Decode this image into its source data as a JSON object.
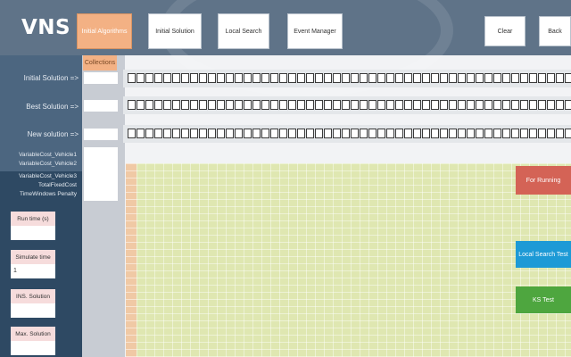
{
  "app": {
    "title": "VNS"
  },
  "toolbar": {
    "buttons": [
      {
        "label": "Initial Algorithms",
        "active": true
      },
      {
        "label": "Initial Solution"
      },
      {
        "label": "Local Search"
      },
      {
        "label": "Event Manager"
      }
    ],
    "clear_label": "Clear",
    "back_label": "Back"
  },
  "sidebar": {
    "collection_label": "Collections",
    "initial_solution_label": "Initial Solution =>",
    "best_solution_label": "Best Solution =>",
    "new_solution_label": "New solution =>",
    "variables": [
      "VariableCost_Vehicle1",
      "VariableCost_Vehicle2",
      "VariableCost_Vehicle3",
      "TotalFixedCost",
      "TimeWindows Penalty"
    ],
    "stats": [
      {
        "label": "Run time (s)",
        "value": ""
      },
      {
        "label": "Simulate time",
        "value": "1"
      },
      {
        "label": "INS. Solution",
        "value": ""
      },
      {
        "label": "Max. Solution",
        "value": ""
      }
    ]
  },
  "actions": {
    "for_running": "For Running",
    "local_search_test": "Local Search Test",
    "ks_test": "KS Test"
  },
  "colors": {
    "header": "#5f7388",
    "sidebar": "#2e4963",
    "active_button": "#f3b184",
    "grid": "#dfe7b1",
    "for_running": "#d46356",
    "local_search_test": "#1d9ad6",
    "ks_test": "#4ea63f"
  }
}
